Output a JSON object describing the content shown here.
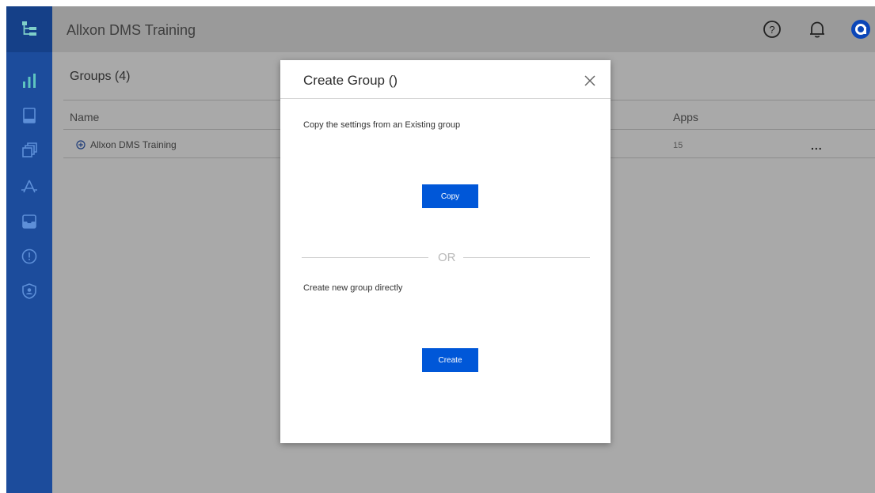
{
  "app": {
    "title": "Allxon DMS Training"
  },
  "sidebar": {
    "items": [
      {
        "icon": "bar-chart-icon"
      },
      {
        "icon": "device-icon"
      },
      {
        "icon": "stack-icon"
      },
      {
        "icon": "app-store-icon"
      },
      {
        "icon": "inbox-icon"
      },
      {
        "icon": "alert-icon"
      },
      {
        "icon": "shield-user-icon"
      }
    ]
  },
  "header": {
    "icons": [
      "help-icon",
      "bell-icon",
      "account-logo-icon"
    ]
  },
  "page": {
    "groups_title": "Groups (4)",
    "columns": {
      "name": "Name",
      "apps": "Apps"
    },
    "rows": [
      {
        "name": "Allxon DMS Training",
        "apps": "15",
        "menu": "..."
      }
    ]
  },
  "modal": {
    "title": "Create Group ()",
    "copy_text": "Copy the settings from an Existing group",
    "copy_button": "Copy",
    "or_text": "OR",
    "create_text": "Create new group directly",
    "create_button": "Create"
  },
  "colors": {
    "sidebar": "#1c4c9c",
    "primary_button": "#0057d8",
    "overlay": "#a9a9a9"
  }
}
